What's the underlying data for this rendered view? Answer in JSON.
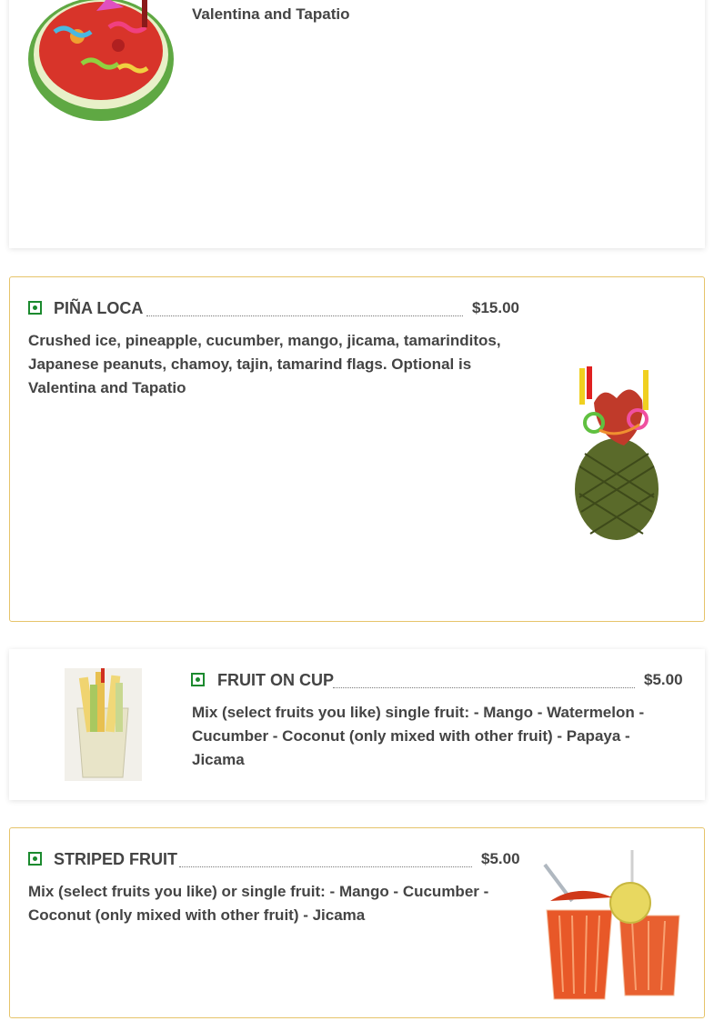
{
  "items": [
    {
      "description_tail": "Valentina and Tapatio",
      "image": "watermelon-bowl-image"
    },
    {
      "title": "PIÑA LOCA",
      "price": "$15.00",
      "description": "Crushed ice, pineapple, cucumber, mango, jicama, tamarinditos, Japanese peanuts, chamoy, tajin, tamarind flags. Optional is Valentina and Tapatio",
      "image": "pineapple-image"
    },
    {
      "title": "FRUIT ON CUP",
      "price": "$5.00",
      "description": "Mix (select fruits you like) single fruit: - Mango - Watermelon - Cucumber - Coconut (only mixed with other fruit) - Papaya - Jicama",
      "image": "fruit-cup-image"
    },
    {
      "title": "STRIPED FRUIT",
      "price": "$5.00",
      "description": "Mix (select fruits you like) or single fruit: - Mango - Cucumber - Coconut (only mixed with other fruit) - Jicama",
      "image": "striped-fruit-cups-image"
    }
  ],
  "colors": {
    "veg_green": "#1b8a2e",
    "border_gold": "#e6c46a",
    "text": "#444444"
  }
}
